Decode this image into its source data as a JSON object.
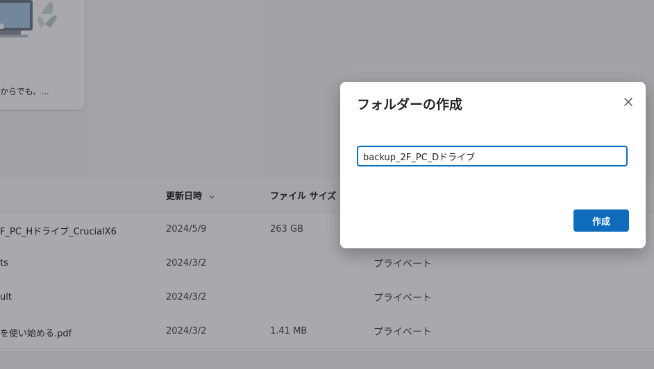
{
  "card": {
    "text": "からでも、...",
    "illustration_icon": "computer-plant-illustration"
  },
  "file_list": {
    "columns": {
      "modified": "更新日時",
      "size": "ファイル サイズ"
    },
    "sort_icon": "chevron-down-icon",
    "rows": [
      {
        "name": "F_PC_Hドライブ_CrucialX6",
        "date": "2024/5/9",
        "size": "263 GB",
        "share": ""
      },
      {
        "name": "ts",
        "date": "2024/3/2",
        "size": "",
        "share": "プライベート"
      },
      {
        "name": "ult",
        "date": "2024/3/2",
        "size": "",
        "share": "プライベート"
      },
      {
        "name": "を使い始める.pdf",
        "date": "2024/3/2",
        "size": "1.41 MB",
        "share": "プライベート"
      }
    ]
  },
  "dialog": {
    "title": "フォルダーの作成",
    "input_value": "backup_2F_PC_Dドライブ",
    "create_label": "作成",
    "close_icon": "close-icon"
  },
  "colors": {
    "accent": "#0f6cbd",
    "overlay": "rgba(30,30,40,0.38)"
  }
}
